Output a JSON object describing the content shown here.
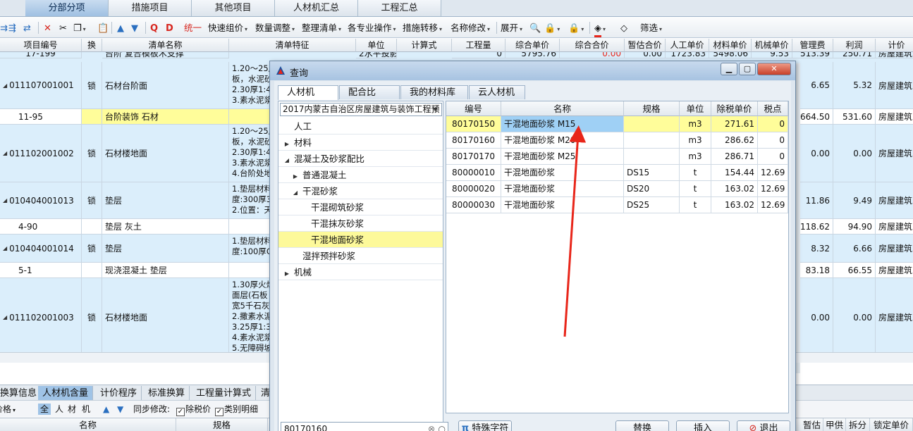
{
  "top_tabs": [
    "分部分项",
    "措施项目",
    "其他项目",
    "人材机汇总",
    "工程汇总"
  ],
  "toolbar": {
    "items": [
      "统一",
      "快速组价",
      "数量调整",
      "整理清单",
      "各专业操作",
      "措施转移",
      "名称修改",
      "展开",
      "筛选"
    ]
  },
  "grid": {
    "columns": [
      "项目编号",
      "换",
      "清单名称",
      "清单特征",
      "单位",
      "计算式",
      "工程量",
      "综合单价",
      "综合合价",
      "暂估合价",
      "人工单价",
      "材料单价",
      "机械单价",
      "管理费",
      "利润",
      "计价"
    ],
    "partial_row": {
      "code": "17-199",
      "name": "台阶 复合模板木支撑",
      "unit": "2水平投影",
      "qty": "0",
      "unit_price": "5795.76",
      "total": "0.00",
      "est": "0.00",
      "labor": "1723.83",
      "material": "5498.06",
      "machine": "9.53",
      "mgmt": "513.39",
      "profit": "250.71",
      "pricing": "房屋建筑"
    },
    "rows": [
      {
        "code": "011107001001",
        "lock": "锁",
        "name": "石材台阶面",
        "features": "1.20～25厚\n板，水泥砂\n2.30厚1:4\n3.素水泥浆",
        "mgmt": "6.65",
        "profit": "5.32",
        "pricing": "房屋建筑",
        "kind": "list"
      },
      {
        "code": "11-95",
        "lock": "",
        "name": "台阶装饰 石材",
        "features": "",
        "mgmt": "664.50",
        "profit": "531.60",
        "pricing": "房屋建筑",
        "kind": "quota-sel"
      },
      {
        "code": "011102001002",
        "lock": "锁",
        "name": "石材楼地面",
        "features": "1.20～25厚\n板，水泥砂\n2.30厚1:4\n3.素水泥浆\n4.台阶处地",
        "mgmt": "0.00",
        "profit": "0.00",
        "pricing": "房屋建筑",
        "kind": "list"
      },
      {
        "code": "010404001013",
        "lock": "锁",
        "name": "垫层",
        "features": "1.垫层材料\n度:300厚3\n2.位置：天",
        "mgmt": "11.86",
        "profit": "9.49",
        "pricing": "房屋建筑",
        "kind": "list"
      },
      {
        "code": "4-90",
        "lock": "",
        "name": "垫层 灰土",
        "features": "",
        "mgmt": "118.62",
        "profit": "94.90",
        "pricing": "房屋建筑",
        "kind": "quota"
      },
      {
        "code": "010404001014",
        "lock": "锁",
        "name": "垫层",
        "features": "1.垫层材料\n度:100厚C",
        "mgmt": "8.32",
        "profit": "6.66",
        "pricing": "房屋建筑",
        "kind": "list"
      },
      {
        "code": "5-1",
        "lock": "",
        "name": "现浇混凝土 垫层",
        "features": "",
        "mgmt": "83.18",
        "profit": "66.55",
        "pricing": "房屋建筑",
        "kind": "quota"
      },
      {
        "code": "011102001003",
        "lock": "锁",
        "name": "石材楼地面",
        "features": "1.30厚火烧\n面层(石板\n宽5千石灰\n2.撒素水泥\n3.25厚1:3\n4.素水泥浆\n5.无障碍坡",
        "mgmt": "0.00",
        "profit": "0.00",
        "pricing": "房屋建筑",
        "kind": "list"
      }
    ]
  },
  "bottom": {
    "tabs": [
      "换算信息",
      "人材机含量",
      "计价程序",
      "标准换算",
      "工程量计算式",
      "清"
    ],
    "bar_left": "价格",
    "filter_all": "全",
    "filter_labor": "人",
    "filter_material": "材",
    "filter_machine": "机",
    "sync_label": "同步修改:",
    "opt1": "除税价",
    "opt2": "类别明细",
    "headers": [
      "名称",
      "规格"
    ],
    "right_headers": [
      "暂估",
      "甲供",
      "拆分",
      "锁定单价"
    ]
  },
  "dialog": {
    "title": "查询",
    "tabs": [
      "人材机",
      "配合比",
      "我的材料库",
      "云人材机"
    ],
    "library": "2017内蒙古自治区房屋建筑与装饰工程预",
    "tree": [
      {
        "label": "人工",
        "arrow": "",
        "indent": 0
      },
      {
        "label": "材料",
        "arrow": "▶",
        "indent": 0
      },
      {
        "label": "混凝土及砂浆配比",
        "arrow": "◢",
        "indent": 0
      },
      {
        "label": "普通混凝土",
        "arrow": "▶",
        "indent": 1
      },
      {
        "label": "干混砂浆",
        "arrow": "◢",
        "indent": 1
      },
      {
        "label": "干混砌筑砂浆",
        "arrow": "",
        "indent": 2
      },
      {
        "label": "干混抹灰砂浆",
        "arrow": "",
        "indent": 2
      },
      {
        "label": "干混地面砂浆",
        "arrow": "",
        "indent": 2,
        "selected": true
      },
      {
        "label": "湿拌预拌砂浆",
        "arrow": "",
        "indent": 1
      },
      {
        "label": "机械",
        "arrow": "▶",
        "indent": 0
      }
    ],
    "columns": [
      "编号",
      "名称",
      "规格",
      "单位",
      "除税单价",
      "税点"
    ],
    "rows": [
      {
        "code": "80170150",
        "name": "干混地面砂浆 M15",
        "spec": "",
        "unit": "m3",
        "price": "271.61",
        "tax": "0",
        "selected": true
      },
      {
        "code": "80170160",
        "name": "干混地面砂浆 M20",
        "spec": "",
        "unit": "m3",
        "price": "286.62",
        "tax": "0"
      },
      {
        "code": "80170170",
        "name": "干混地面砂浆 M25",
        "spec": "",
        "unit": "m3",
        "price": "286.71",
        "tax": "0"
      },
      {
        "code": "80000010",
        "name": "干混地面砂浆",
        "spec": "DS15",
        "unit": "t",
        "price": "154.44",
        "tax": "12.69"
      },
      {
        "code": "80000020",
        "name": "干混地面砂浆",
        "spec": "DS20",
        "unit": "t",
        "price": "163.02",
        "tax": "12.69"
      },
      {
        "code": "80000030",
        "name": "干混地面砂浆",
        "spec": "DS25",
        "unit": "t",
        "price": "163.02",
        "tax": "12.69"
      }
    ],
    "search_value": "80170160",
    "special_char_label": "特殊字符",
    "replace_label": "替换",
    "insert_label": "插入",
    "exit_label": "退出"
  },
  "colors": {
    "list_row": "#dbeefb",
    "quota_row": "#ffffff",
    "selected_row": "#fffd9a",
    "accent": "#9fc3e6",
    "arrow": "#e8261a"
  }
}
